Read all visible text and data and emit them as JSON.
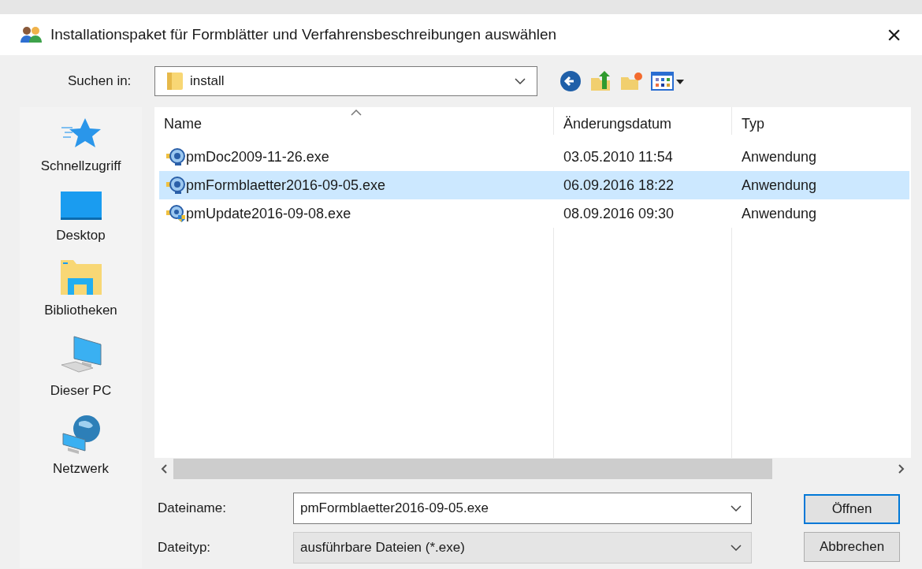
{
  "window": {
    "title": "Installationspaket für Formblätter und Verfahrensbeschreibungen auswählen",
    "close": "×"
  },
  "look_in": {
    "label": "Suchen in:",
    "value": "install"
  },
  "places": [
    {
      "label": "Schnellzugriff",
      "kind": "star"
    },
    {
      "label": "Desktop",
      "kind": "desktop"
    },
    {
      "label": "Bibliotheken",
      "kind": "library"
    },
    {
      "label": "Dieser PC",
      "kind": "pc"
    },
    {
      "label": "Netzwerk",
      "kind": "network"
    }
  ],
  "table": {
    "columns": [
      "Name",
      "Änderungsdatum",
      "Typ"
    ],
    "rows": [
      {
        "name": "pmDoc2009-11-26.exe",
        "date": "03.05.2010 11:54",
        "type": "Anwendung",
        "selected": false,
        "kind": "app"
      },
      {
        "name": "pmFormblaetter2016-09-05.exe",
        "date": "06.09.2016 18:22",
        "type": "Anwendung",
        "selected": true,
        "kind": "app"
      },
      {
        "name": "pmUpdate2016-09-08.exe",
        "date": "08.09.2016 09:30",
        "type": "Anwendung",
        "selected": false,
        "kind": "shield"
      }
    ]
  },
  "file_name": {
    "label": "Dateiname:",
    "value": "pmFormblaetter2016-09-05.exe"
  },
  "file_type": {
    "label": "Dateityp:",
    "value": "ausführbare Dateien (*.exe)"
  },
  "buttons": [
    "Öffnen",
    "Abbrechen"
  ]
}
